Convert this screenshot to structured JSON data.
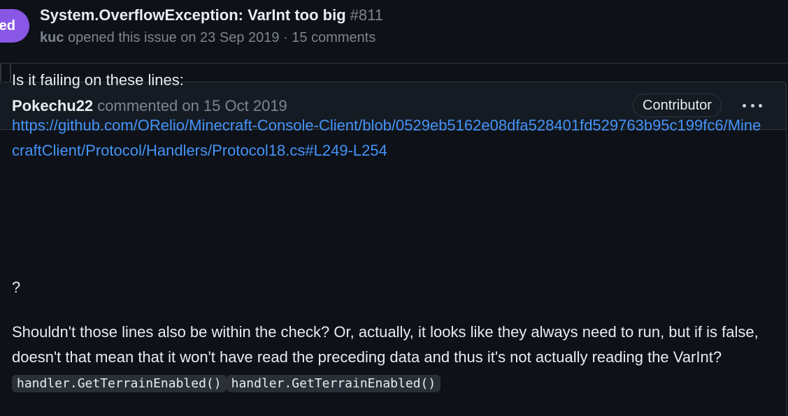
{
  "issue": {
    "state_label": "ed",
    "title": "System.OverflowException: VarInt too big",
    "number": "#811",
    "author": "kuc",
    "meta_rest": "opened this issue on 23 Sep 2019 · 15 comments"
  },
  "comment": {
    "author": "Pokechu22",
    "meta": "commented on 15 Oct 2019",
    "role_badge": "Contributor",
    "menu_icon": "kebab-horizontal-icon",
    "body": {
      "line1": "Is it failing on these lines:",
      "link": "https://github.com/ORelio/Minecraft-Console-Client/blob/0529eb5162e08dfa528401fd529763b95c199fc6/MinecraftClient/Protocol/Handlers/Protocol18.cs#L249-L254",
      "question": "?",
      "text_before_code": "Shouldn't those lines also be within the check? Or, actually, it looks like they always need to run, but if is false, doesn't that mean that it won't have read the preceding data and thus it's not actually reading the VarInt?",
      "code1": "handler.GetTerrainEnabled()",
      "code2": "handler.GetTerrainEnabled()"
    }
  },
  "colors": {
    "background": "#0e1117",
    "header_bg": "#151b23",
    "border": "#30363d",
    "text": "#e6edf3",
    "muted": "#7d8590",
    "link": "#4493f8",
    "closed_badge": "#8957e5"
  }
}
